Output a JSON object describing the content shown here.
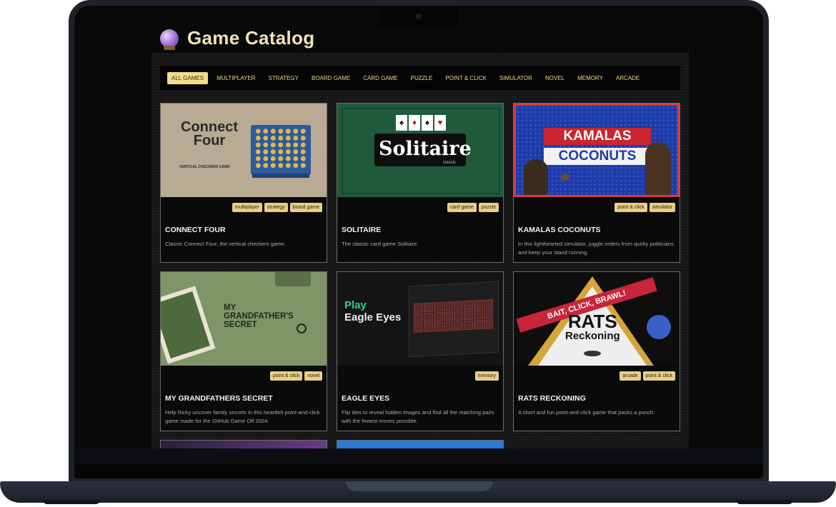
{
  "app": {
    "title": "Game Catalog",
    "icon": "crystal-ball-icon"
  },
  "filters": [
    {
      "label": "ALL GAMES",
      "active": true
    },
    {
      "label": "MULTIPLAYER",
      "active": false
    },
    {
      "label": "STRATEGY",
      "active": false
    },
    {
      "label": "BOARD GAME",
      "active": false
    },
    {
      "label": "CARD GAME",
      "active": false
    },
    {
      "label": "PUZZLE",
      "active": false
    },
    {
      "label": "POINT & CLICK",
      "active": false
    },
    {
      "label": "SIMULATOR",
      "active": false
    },
    {
      "label": "NOVEL",
      "active": false
    },
    {
      "label": "MEMORY",
      "active": false
    },
    {
      "label": "ARCADE",
      "active": false
    }
  ],
  "games": [
    {
      "title": "CONNECT FOUR",
      "tags": [
        "multiplayer",
        "strategy",
        "board game"
      ],
      "description": "Classic Connect Four, the vertical checkers game.",
      "thumb": {
        "line1": "Connect",
        "line2": "Four",
        "subtitle": "VERTICAL CHECKERS GAME"
      }
    },
    {
      "title": "SOLITAIRE",
      "tags": [
        "card game",
        "puzzle"
      ],
      "description": "The classic card game Solitaire.",
      "thumb": {
        "word": "Solitaire",
        "sub": "classic"
      }
    },
    {
      "title": "KAMALAS COCONUTS",
      "tags": [
        "point & click",
        "simulator"
      ],
      "description": "In this lighthearted simulator, juggle orders from quirky politicians and keep your stand running.",
      "thumb": {
        "line1": "KAMALAS",
        "line2": "COCONUTS"
      }
    },
    {
      "title": "MY GRANDFATHERS SECRET",
      "tags": [
        "point & click",
        "novel"
      ],
      "description": "Help Ricky uncover family secrets in this heartfelt point-and-click game made for the GitHub Game Off 2024.",
      "thumb": {
        "line1": "MY",
        "line2": "GRANDFATHER'S",
        "line3": "SECRET"
      }
    },
    {
      "title": "EAGLE EYES",
      "tags": [
        "memory"
      ],
      "description": "Flip tiles to reveal hidden images and find all the matching pairs with the fewest moves possible.",
      "thumb": {
        "line1": "Play",
        "line2": "Eagle Eyes"
      }
    },
    {
      "title": "RATS RECKONING",
      "tags": [
        "arcade",
        "point & click"
      ],
      "description": "A short and fun point-and-click game that packs a punch.",
      "thumb": {
        "banner": "BAIT, CLICK, BRAWL!",
        "line1": "RATS",
        "line2": "Reckoning"
      }
    }
  ]
}
